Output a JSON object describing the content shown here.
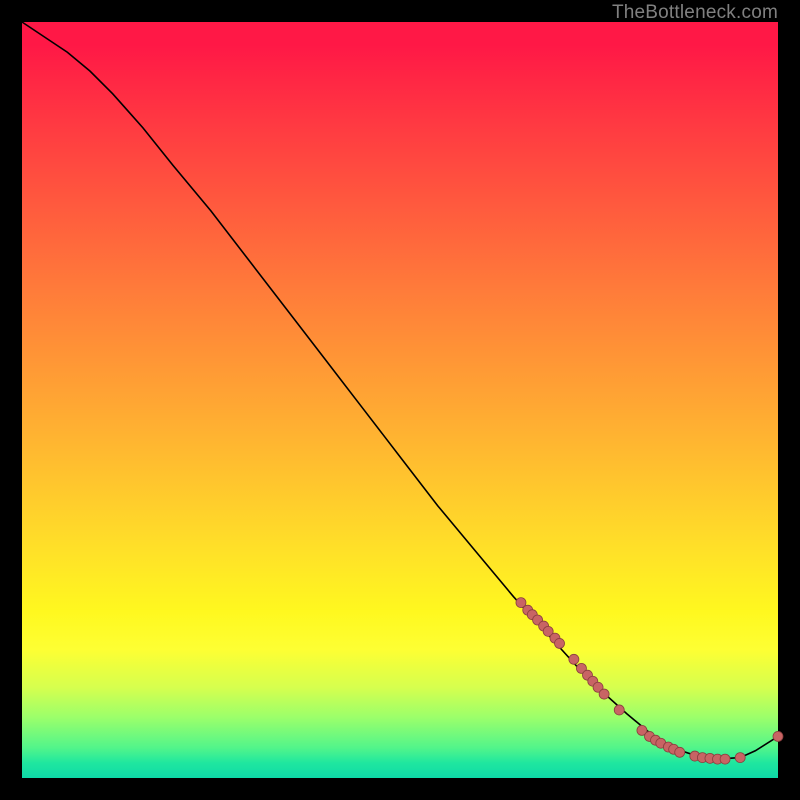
{
  "watermark": "TheBottleneck.com",
  "colors": {
    "background": "#000000",
    "curve_stroke": "#000000",
    "marker_fill": "#c86464",
    "marker_stroke": "#8a3f3f"
  },
  "chart_data": {
    "type": "line",
    "title": "",
    "xlabel": "",
    "ylabel": "",
    "xlim": [
      0,
      100
    ],
    "ylim": [
      0,
      100
    ],
    "grid": false,
    "legend": null,
    "series": [
      {
        "name": "curve",
        "x": [
          0,
          3,
          6,
          9,
          12,
          16,
          20,
          25,
          30,
          35,
          40,
          45,
          50,
          55,
          60,
          65,
          70,
          75,
          80,
          83,
          86,
          89,
          92,
          95,
          97,
          100
        ],
        "y": [
          100,
          98,
          96,
          93.5,
          90.5,
          86,
          81,
          75,
          68.5,
          62,
          55.5,
          49,
          42.5,
          36,
          30,
          24,
          18.5,
          13,
          8.5,
          6,
          4,
          3,
          2.5,
          2.7,
          3.6,
          5.5
        ]
      }
    ],
    "markers": [
      {
        "x": 66.0,
        "y": 23.2
      },
      {
        "x": 66.9,
        "y": 22.2
      },
      {
        "x": 67.5,
        "y": 21.6
      },
      {
        "x": 68.2,
        "y": 20.9
      },
      {
        "x": 69.0,
        "y": 20.1
      },
      {
        "x": 69.6,
        "y": 19.4
      },
      {
        "x": 70.5,
        "y": 18.5
      },
      {
        "x": 71.1,
        "y": 17.8
      },
      {
        "x": 73.0,
        "y": 15.7
      },
      {
        "x": 74.0,
        "y": 14.5
      },
      {
        "x": 74.8,
        "y": 13.6
      },
      {
        "x": 75.5,
        "y": 12.8
      },
      {
        "x": 76.2,
        "y": 12.0
      },
      {
        "x": 77.0,
        "y": 11.1
      },
      {
        "x": 79.0,
        "y": 9.0
      },
      {
        "x": 82.0,
        "y": 6.3
      },
      {
        "x": 83.0,
        "y": 5.5
      },
      {
        "x": 83.8,
        "y": 5.0
      },
      {
        "x": 84.5,
        "y": 4.6
      },
      {
        "x": 85.5,
        "y": 4.1
      },
      {
        "x": 86.2,
        "y": 3.8
      },
      {
        "x": 87.0,
        "y": 3.4
      },
      {
        "x": 89.0,
        "y": 2.9
      },
      {
        "x": 90.0,
        "y": 2.7
      },
      {
        "x": 91.0,
        "y": 2.6
      },
      {
        "x": 92.0,
        "y": 2.5
      },
      {
        "x": 93.0,
        "y": 2.5
      },
      {
        "x": 95.0,
        "y": 2.7
      },
      {
        "x": 100.0,
        "y": 5.5
      }
    ]
  }
}
